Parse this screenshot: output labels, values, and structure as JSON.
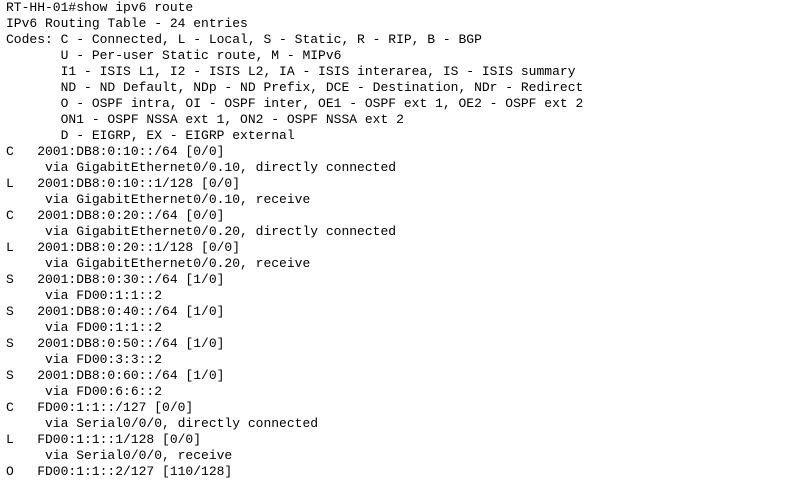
{
  "terminal": {
    "lines": [
      "RT-HH-01#show ipv6 route",
      "IPv6 Routing Table - 24 entries",
      "Codes: C - Connected, L - Local, S - Static, R - RIP, B - BGP",
      "       U - Per-user Static route, M - MIPv6",
      "       I1 - ISIS L1, I2 - ISIS L2, IA - ISIS interarea, IS - ISIS summary",
      "       ND - ND Default, NDp - ND Prefix, DCE - Destination, NDr - Redirect",
      "       O - OSPF intra, OI - OSPF inter, OE1 - OSPF ext 1, OE2 - OSPF ext 2",
      "       ON1 - OSPF NSSA ext 1, ON2 - OSPF NSSA ext 2",
      "       D - EIGRP, EX - EIGRP external",
      "C   2001:DB8:0:10::/64 [0/0]",
      "     via GigabitEthernet0/0.10, directly connected",
      "L   2001:DB8:0:10::1/128 [0/0]",
      "     via GigabitEthernet0/0.10, receive",
      "C   2001:DB8:0:20::/64 [0/0]",
      "     via GigabitEthernet0/0.20, directly connected",
      "L   2001:DB8:0:20::1/128 [0/0]",
      "     via GigabitEthernet0/0.20, receive",
      "S   2001:DB8:0:30::/64 [1/0]",
      "     via FD00:1:1::2",
      "S   2001:DB8:0:40::/64 [1/0]",
      "     via FD00:1:1::2",
      "S   2001:DB8:0:50::/64 [1/0]",
      "     via FD00:3:3::2",
      "S   2001:DB8:0:60::/64 [1/0]",
      "     via FD00:6:6::2",
      "C   FD00:1:1::/127 [0/0]",
      "     via Serial0/0/0, directly connected",
      "L   FD00:1:1::1/128 [0/0]",
      "     via Serial0/0/0, receive",
      "O   FD00:1:1::2/127 [110/128]"
    ]
  }
}
